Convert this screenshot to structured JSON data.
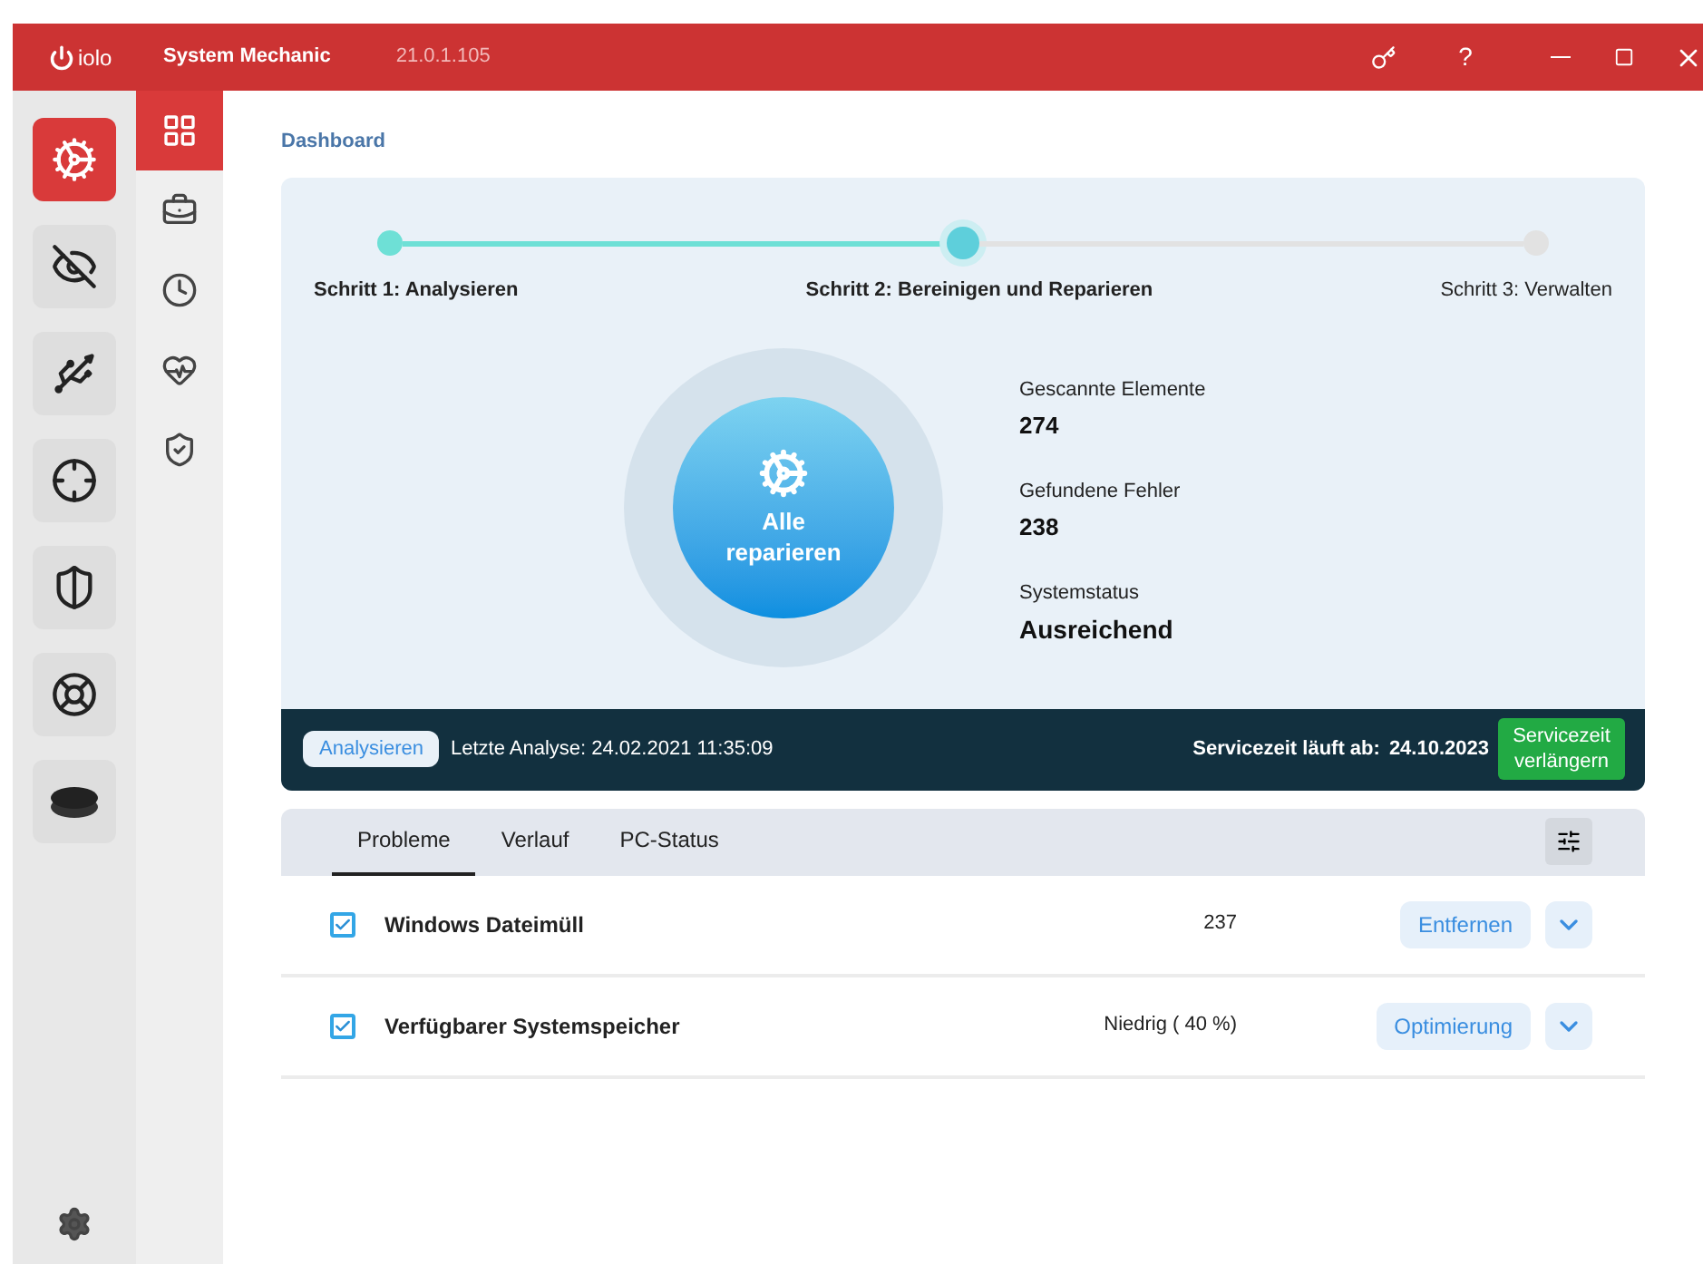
{
  "titlebar": {
    "logo": "iolo",
    "title": "System Mechanic",
    "version": "21.0.1.105",
    "help": "?"
  },
  "rail": [
    {
      "kind": "gear",
      "selected": true
    },
    {
      "kind": "eye-off",
      "selected": false
    },
    {
      "kind": "usb",
      "selected": false
    },
    {
      "kind": "crosshair",
      "selected": false
    },
    {
      "kind": "shield",
      "selected": false
    },
    {
      "kind": "lifebuoy",
      "selected": false
    },
    {
      "kind": "puck",
      "selected": false
    }
  ],
  "subnav": [
    {
      "kind": "grid",
      "selected": true
    },
    {
      "kind": "toolbox",
      "selected": false
    },
    {
      "kind": "clock",
      "selected": false
    },
    {
      "kind": "heart",
      "selected": false
    },
    {
      "kind": "shield-check",
      "selected": false
    }
  ],
  "breadcrumb": "Dashboard",
  "steps": [
    {
      "label": "Schritt 1: Analysieren",
      "done": true,
      "selected": false
    },
    {
      "label": "Schritt 2: Bereinigen und Reparieren",
      "done": false,
      "selected": true
    },
    {
      "label": "Schritt 3: Verwalten",
      "done": false,
      "selected": false
    }
  ],
  "repair_button": "Alle reparieren",
  "stats": [
    {
      "label": "Gescannte Elemente",
      "value": "274"
    },
    {
      "label": "Gefundene Fehler",
      "value": "238"
    },
    {
      "label": "Systemstatus",
      "value": "Ausreichend"
    }
  ],
  "status_bar": {
    "analyze_button": "Analysieren",
    "last_analysis": "Letzte Analyse: 24.02.2021 11:35:09",
    "service_label": "Servicezeit läuft ab:",
    "service_date": "24.10.2023",
    "extend_button": "Servicezeit verlängern"
  },
  "tabs": [
    {
      "label": "Probleme",
      "selected": true
    },
    {
      "label": "Verlauf",
      "selected": false
    },
    {
      "label": "PC-Status",
      "selected": false
    }
  ],
  "problems": [
    {
      "name": "Windows Dateimüll",
      "checked": true,
      "value": "237",
      "action": "Entfernen"
    },
    {
      "name": "Verfügbarer Systemspeicher",
      "checked": true,
      "value": "Niedrig ( 40 %)",
      "action": "Optimierung"
    }
  ]
}
